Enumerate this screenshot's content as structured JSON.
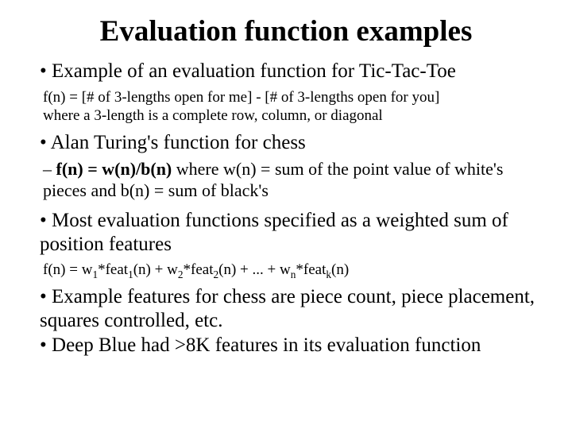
{
  "title": "Evaluation function examples",
  "bullet1": "Example of an evaluation function for Tic-Tac-Toe",
  "sub1_line1": "f(n) = [# of 3-lengths open for me] - [# of 3-lengths open for you]",
  "sub1_line2": "where a 3-length is a complete row, column, or diagonal",
  "bullet2": "Alan Turing's function for chess",
  "sub2_line1_pre": "f(n) = w(n)/b(n)",
  "sub2_line1_post": " where w(n) = sum of the point value of white's pieces and b(n) = sum of black's",
  "bullet3": "Most evaluation functions specified as a weighted sum of position features",
  "formula": {
    "w1": "w",
    "s1": "1",
    "f1": "*feat",
    "fs1": "1",
    "n1": "(n) + ",
    "w2": "w",
    "s2": "2",
    "f2": "*feat",
    "fs2": "2",
    "n2": "(n) + ... + ",
    "wn": "w",
    "sn": "n",
    "fn": "*feat",
    "fsn": "k",
    "nn": "(n)",
    "prefix": "f(n) = "
  },
  "bullet4": "Example features for chess are piece count,  piece placement, squares controlled, etc.",
  "bullet5": "Deep Blue had >8K features in its evaluation function"
}
